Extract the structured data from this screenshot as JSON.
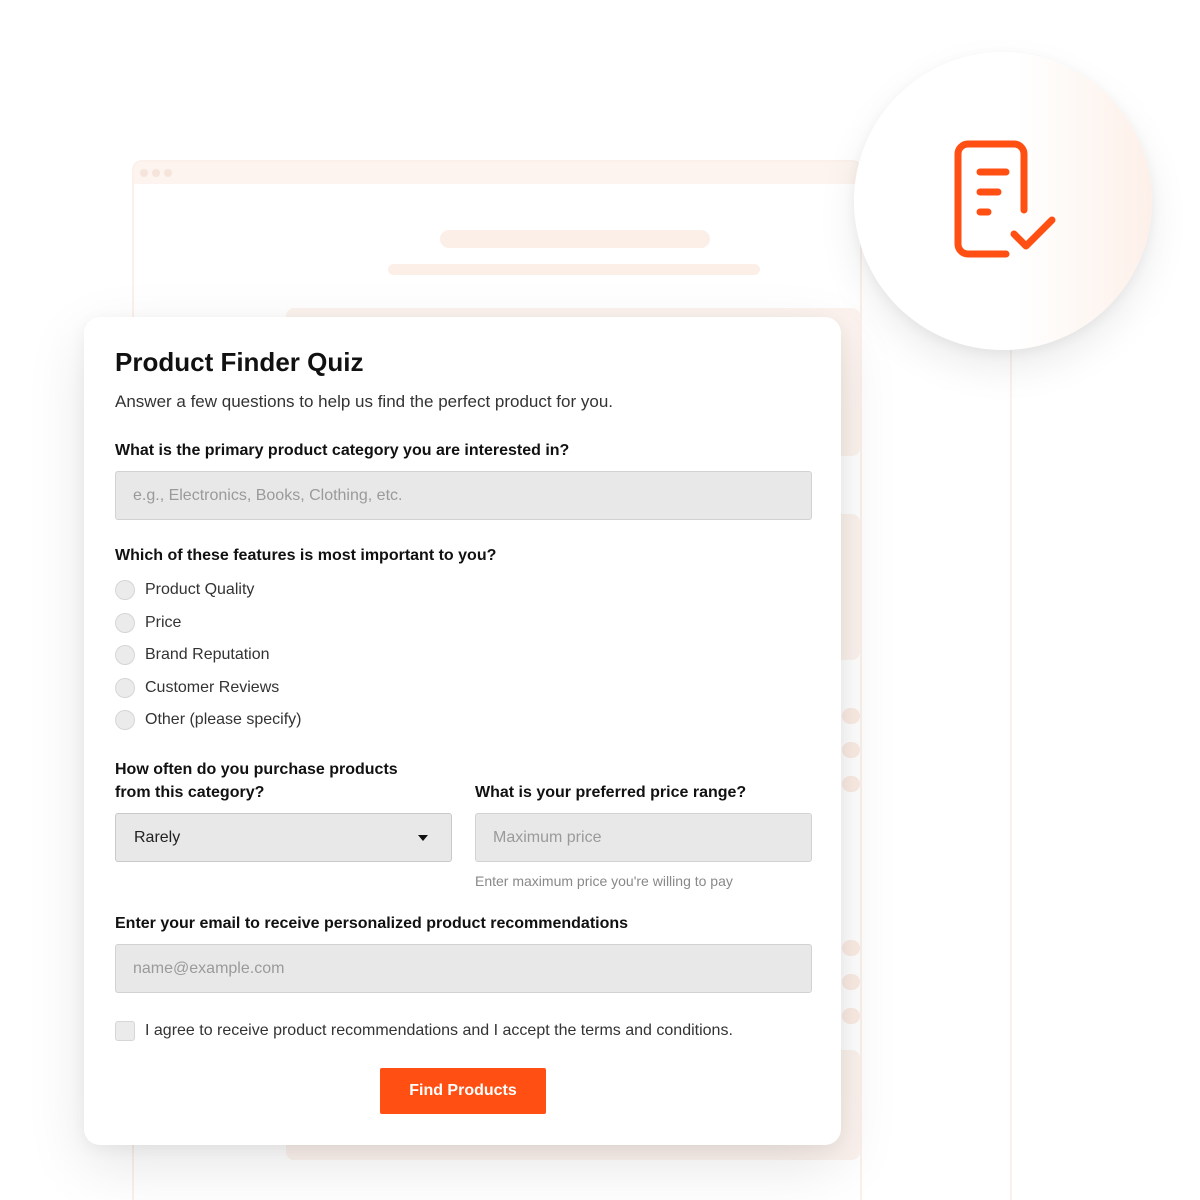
{
  "form": {
    "title": "Product Finder Quiz",
    "subtitle": "Answer a few questions to help us find the perfect product for you.",
    "category": {
      "label": "What is the primary product category you are interested in?",
      "placeholder": "e.g., Electronics, Books, Clothing, etc.",
      "value": ""
    },
    "features": {
      "label": "Which of these features is most important to you?",
      "options": [
        "Product Quality",
        "Price",
        "Brand Reputation",
        "Customer Reviews",
        "Other (please specify)"
      ],
      "selected": null
    },
    "frequency": {
      "label_line1": "How often do you purchase products",
      "label_line2": "from this category?",
      "selected": "Rarely"
    },
    "price": {
      "label": "What is your preferred price range?",
      "placeholder": "Maximum price",
      "hint": "Enter maximum price you're willing to pay",
      "value": ""
    },
    "email": {
      "label": "Enter your email to receive personalized product recommendations",
      "placeholder": "name@example.com",
      "value": ""
    },
    "consent": {
      "label": "I agree to receive product recommendations and I accept the terms and conditions.",
      "checked": false
    },
    "submit_label": "Find Products"
  },
  "badge": {
    "icon": "document-check-icon",
    "color": "#ff4f12"
  },
  "colors": {
    "accent": "#ff4f12",
    "field_bg": "#e8e8e8",
    "decor": "#fdf3ee"
  }
}
